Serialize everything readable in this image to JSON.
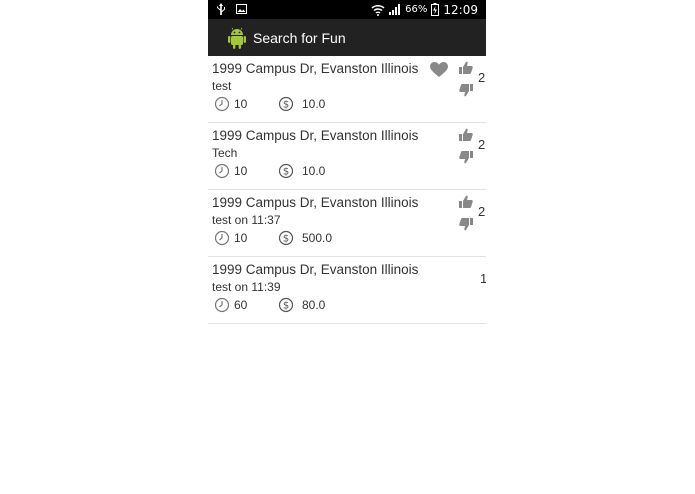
{
  "status_bar": {
    "battery_percent": "66%",
    "time": "12:09"
  },
  "action_bar": {
    "title": "Search for Fun"
  },
  "colors": {
    "action_bar_bg": "#222222",
    "status_bar_bg": "#000000",
    "icon_gray": "#888888",
    "android_green": "#a4c639"
  },
  "items": [
    {
      "address": "1999 Campus Dr, Evanston Illinois",
      "description": "test",
      "time": "10",
      "price": "10.0",
      "score": "2",
      "favorited": true,
      "voting": true
    },
    {
      "address": "1999 Campus Dr, Evanston Illinois",
      "description": "Tech",
      "time": "10",
      "price": "10.0",
      "score": "2",
      "favorited": false,
      "voting": true
    },
    {
      "address": "1999 Campus Dr, Evanston Illinois",
      "description": "test on 11:37",
      "time": "10",
      "price": "500.0",
      "score": "2",
      "favorited": false,
      "voting": true
    },
    {
      "address": "1999 Campus Dr, Evanston Illinois",
      "description": "test on 11:39",
      "time": "60",
      "price": "80.0",
      "score": "1",
      "favorited": false,
      "voting": false
    }
  ]
}
